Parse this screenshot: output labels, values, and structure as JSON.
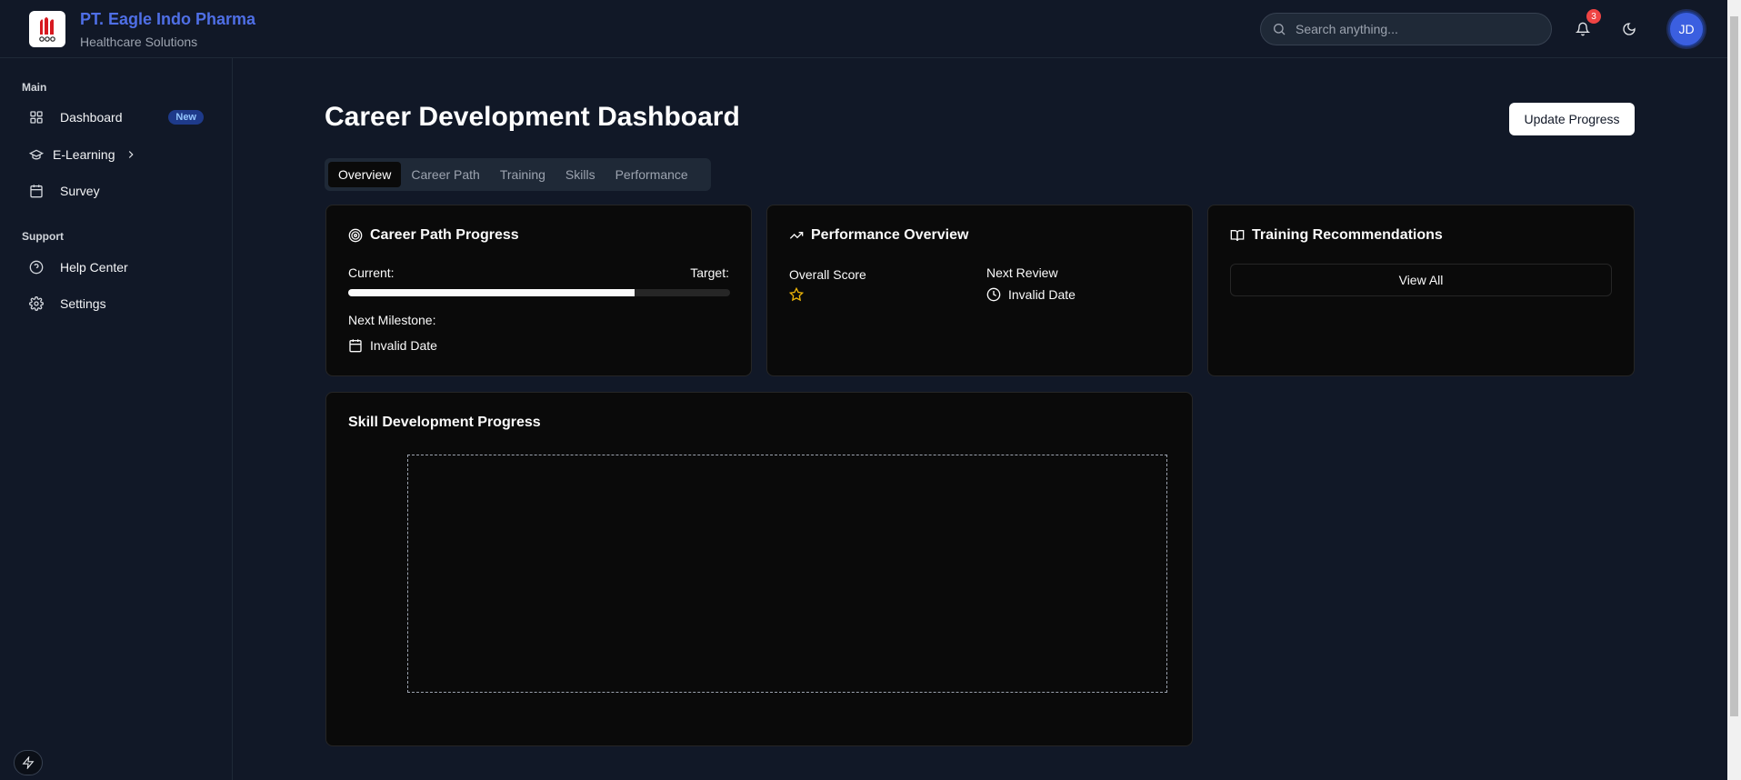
{
  "header": {
    "brand_name": "PT. Eagle Indo Pharma",
    "brand_subtitle": "Healthcare Solutions",
    "search_placeholder": "Search anything...",
    "notification_count": "3",
    "avatar_initials": "JD"
  },
  "sidebar": {
    "sections": [
      {
        "heading": "Main",
        "items": [
          {
            "label": "Dashboard",
            "icon": "grid-icon",
            "badge": "New"
          },
          {
            "label": "E-Learning",
            "icon": "graduation-cap-icon"
          },
          {
            "label": "Survey",
            "icon": "calendar-icon"
          }
        ]
      },
      {
        "heading": "Support",
        "items": [
          {
            "label": "Help Center",
            "icon": "help-circle-icon"
          },
          {
            "label": "Settings",
            "icon": "gear-icon"
          }
        ]
      }
    ]
  },
  "main": {
    "title": "Career Development Dashboard",
    "update_button": "Update Progress",
    "tabs": [
      {
        "label": "Overview",
        "active": true
      },
      {
        "label": "Career Path"
      },
      {
        "label": "Training"
      },
      {
        "label": "Skills"
      },
      {
        "label": "Performance"
      }
    ],
    "career_card": {
      "title": "Career Path Progress",
      "current_label": "Current:",
      "target_label": "Target:",
      "progress_fraction": 0.75,
      "milestone_label": "Next Milestone:",
      "milestone_date": "Invalid Date"
    },
    "performance_card": {
      "title": "Performance Overview",
      "score_label": "Overall Score",
      "review_label": "Next Review",
      "review_date": "Invalid Date"
    },
    "training_card": {
      "title": "Training Recommendations",
      "view_all": "View All"
    },
    "skill_card": {
      "title": "Skill Development Progress"
    }
  },
  "colors": {
    "brand": "#4f6fe6",
    "background": "#111827",
    "card": "#0a0a0a",
    "badge": "#ef4444",
    "star": "#eab308"
  }
}
